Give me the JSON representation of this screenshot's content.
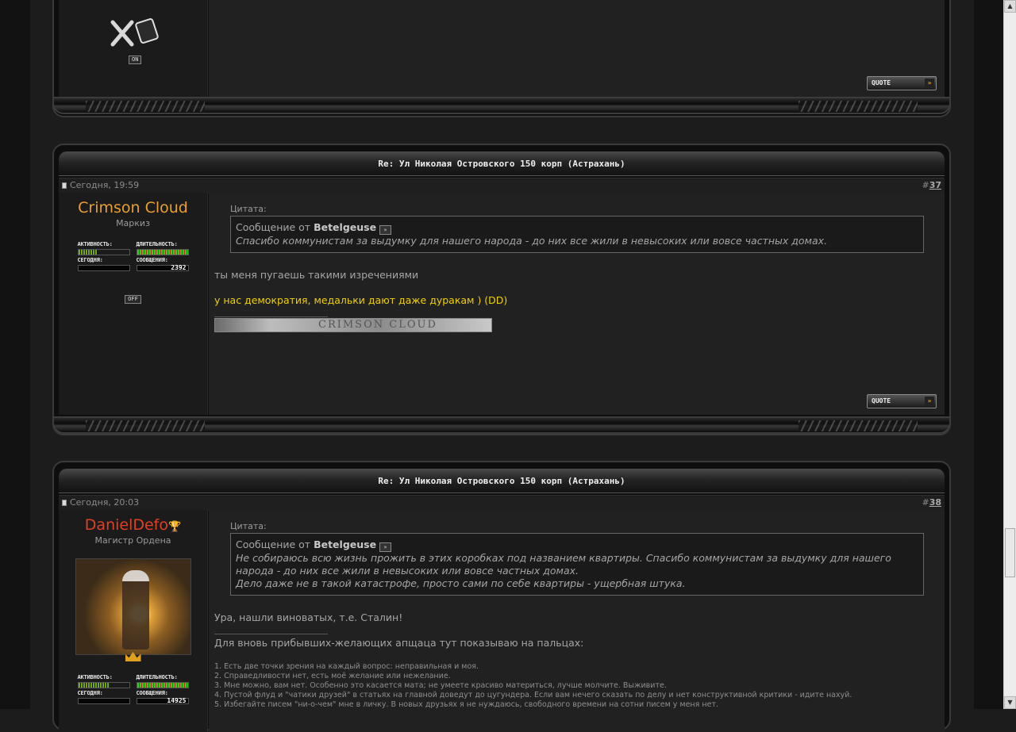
{
  "colors": {
    "background": "#1c1c1c",
    "crimson_name": "#e8a030",
    "daniel_name": "#e04020",
    "highlight_text": "#f0d000"
  },
  "post36": {
    "tiny_button": "ON",
    "quote_button": "QUOTE"
  },
  "post37": {
    "title": "Re: Ул Николая Островского 150 корп (Астрахань)",
    "date": "Сегодня, 19:59",
    "number_prefix": "#",
    "number": "37",
    "username": "Crimson Cloud",
    "rank": "Маркиз",
    "stats": {
      "activity_label": "АКТИВНОСТЬ:",
      "duration_label": "ДЛИТЕЛЬНОСТЬ:",
      "today_label": "СЕГОДНЯ:",
      "posts_label": "СООБЩЕНИЯ:",
      "posts_count": "2392"
    },
    "status_button": "OFF",
    "quote_label": "Цитата:",
    "quote_from_prefix": "Сообщение от",
    "quote_author": "Betelgeuse",
    "quote_text": "Спасибо коммунистам за выдумку для нашего народа - до них все жили в невысоких или вовсе частных домах.",
    "message_line1": "ты меня пугаешь такими изречениями",
    "message_line2": "у нас демократия, медальки дают даже дуракам ) (DD)",
    "signature_banner": "CRIMSON CLOUD",
    "quote_button": "QUOTE"
  },
  "post38": {
    "title": "Re: Ул Николая Островского 150 корп (Астрахань)",
    "date": "Сегодня, 20:03",
    "number_prefix": "#",
    "number": "38",
    "username": "DanielDefo",
    "rank": "Магистр Ордена",
    "stats": {
      "activity_label": "АКТИВНОСТЬ:",
      "duration_label": "ДЛИТЕЛЬНОСТЬ:",
      "today_label": "СЕГОДНЯ:",
      "posts_label": "СООБЩЕНИЯ:",
      "posts_count": "14925"
    },
    "quote_label": "Цитата:",
    "quote_from_prefix": "Сообщение от",
    "quote_author": "Betelgeuse",
    "quote_text_1": "Не собираюсь всю жизнь прожить в этих коробках под названием квартиры. Спасибо коммунистам за выдумку для нашего народа - до них все жили в невысоких или вовсе частных домах.",
    "quote_text_2": "Дело даже не в такой катастрофе, просто сами по себе квартиры - ущербная штука.",
    "message_line1": "Ура, нашли виноватых, т.е. Сталин!",
    "signature_intro": "Для вновь прибывших-желающих апщаца тут показываю на пальцах:",
    "rules": [
      "1. Есть две точки зрения на каждый вопрос: неправильная и моя.",
      "2. Справедливости нет, есть моё желание или нежелание.",
      "3. Мне можно, вам нет. Особенно это касается мата; не умеете красиво материться, лучше молчите. Выживите.",
      "4. Пустой флуд и \"чатики друзей\" в статьях на главной доведут до цугундера. Если вам нечего сказать по делу и нет конструктивной критики - идите нахуй.",
      "5. Избегайте писем \"ни-о-чем\" мне в личку. В новых друзьях я не нуждаюсь, свободного времени на сотни писем у меня нет."
    ]
  }
}
